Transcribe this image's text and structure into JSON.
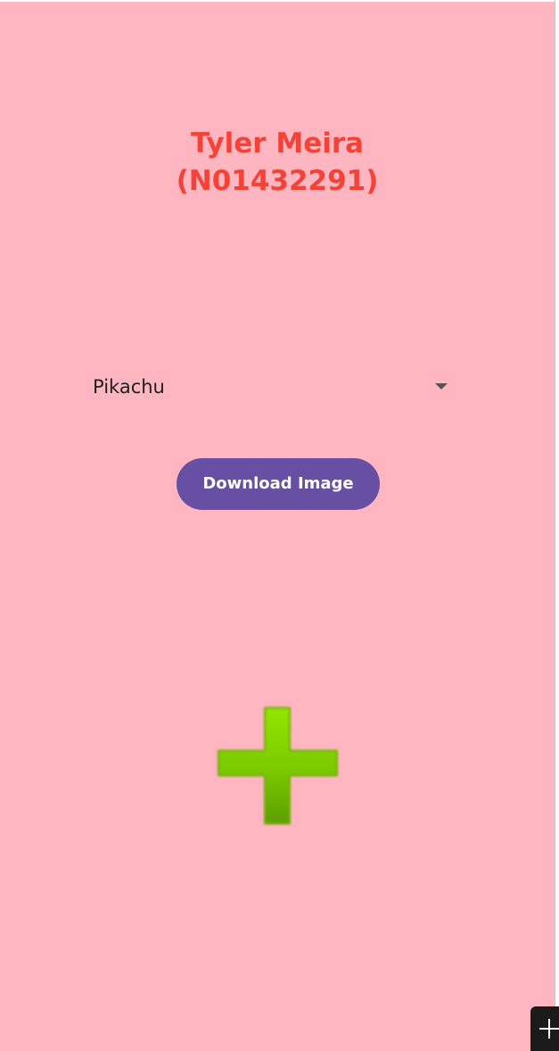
{
  "app": {
    "background_color": "#FFB6C1"
  },
  "header": {
    "name": "Tyler Meira",
    "student_id": "(N01432291)",
    "color": "#F44336"
  },
  "spinner": {
    "selected": "Pikachu"
  },
  "download_button": {
    "label": "Download Image",
    "color": "#6750A4"
  },
  "image": {
    "icon": "green-plus-icon"
  },
  "overlay": {
    "icon": "plus-icon"
  }
}
